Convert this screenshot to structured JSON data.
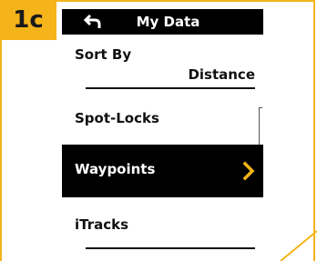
{
  "step": {
    "label": "1c"
  },
  "header": {
    "title": "My Data",
    "back_icon": "back-arrow-icon"
  },
  "sort": {
    "label": "Sort By",
    "value": "Distance"
  },
  "menu": {
    "items": [
      {
        "label": "Spot-Locks",
        "selected": false
      },
      {
        "label": "Waypoints",
        "selected": true
      },
      {
        "label": "iTracks",
        "selected": false
      }
    ]
  },
  "colors": {
    "accent": "#f4b41a",
    "chevron": "#f4b41a",
    "background": "#ffffff",
    "bar": "#000000"
  }
}
